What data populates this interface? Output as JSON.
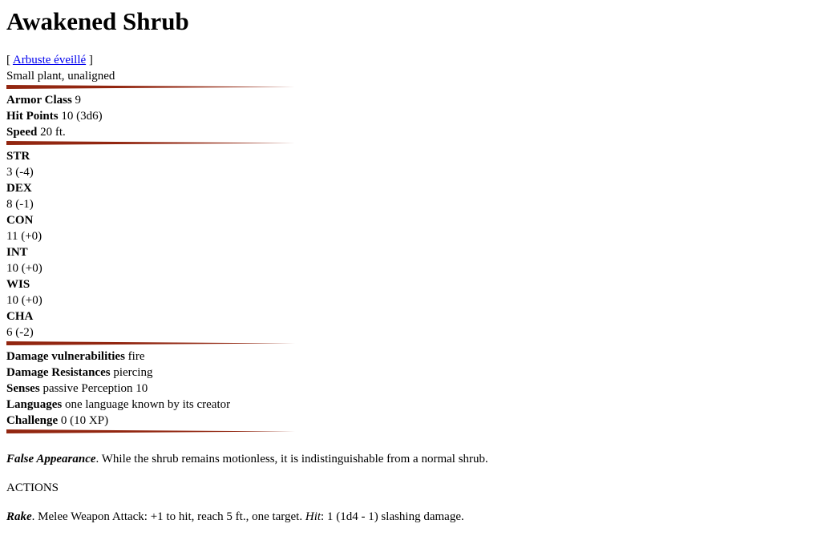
{
  "title": "Awakened Shrub",
  "alt_name": {
    "open": "[ ",
    "link": "Arbuste éveillé",
    "close": " ]"
  },
  "meta": "Small plant, unaligned",
  "rule_color": "#922610",
  "defense": {
    "armor_class": {
      "label": "Armor Class",
      "value": " 9"
    },
    "hit_points": {
      "label": "Hit Points",
      "value": " 10 (3d6)"
    },
    "speed": {
      "label": "Speed",
      "value": " 20 ft."
    }
  },
  "abilities": [
    {
      "name": "STR",
      "value": "3 (-4)"
    },
    {
      "name": "DEX",
      "value": "8 (-1)"
    },
    {
      "name": "CON",
      "value": "11 (+0)"
    },
    {
      "name": "INT",
      "value": "10 (+0)"
    },
    {
      "name": "WIS",
      "value": "10 (+0)"
    },
    {
      "name": "CHA",
      "value": "6 (-2)"
    }
  ],
  "properties": {
    "vulnerabilities": {
      "label": "Damage vulnerabilities",
      "value": " fire"
    },
    "resistances": {
      "label": "Damage Resistances",
      "value": " piercing"
    },
    "senses": {
      "label": "Senses",
      "value": " passive Perception 10"
    },
    "languages": {
      "label": "Languages",
      "value": " one language known by its creator"
    },
    "challenge": {
      "label": "Challenge",
      "value": " 0 (10 XP)"
    }
  },
  "trait": {
    "name": "False Appearance",
    "text": ". While the shrub remains motionless, it is indistinguishable from a normal shrub."
  },
  "actions_heading": "ACTIONS",
  "action": {
    "name": "Rake",
    "text1": ". Melee Weapon Attack: +1 to hit, reach 5 ft., one target. ",
    "hit_label": "Hit",
    "text2": ": 1 (1d4 - 1) slashing damage."
  }
}
